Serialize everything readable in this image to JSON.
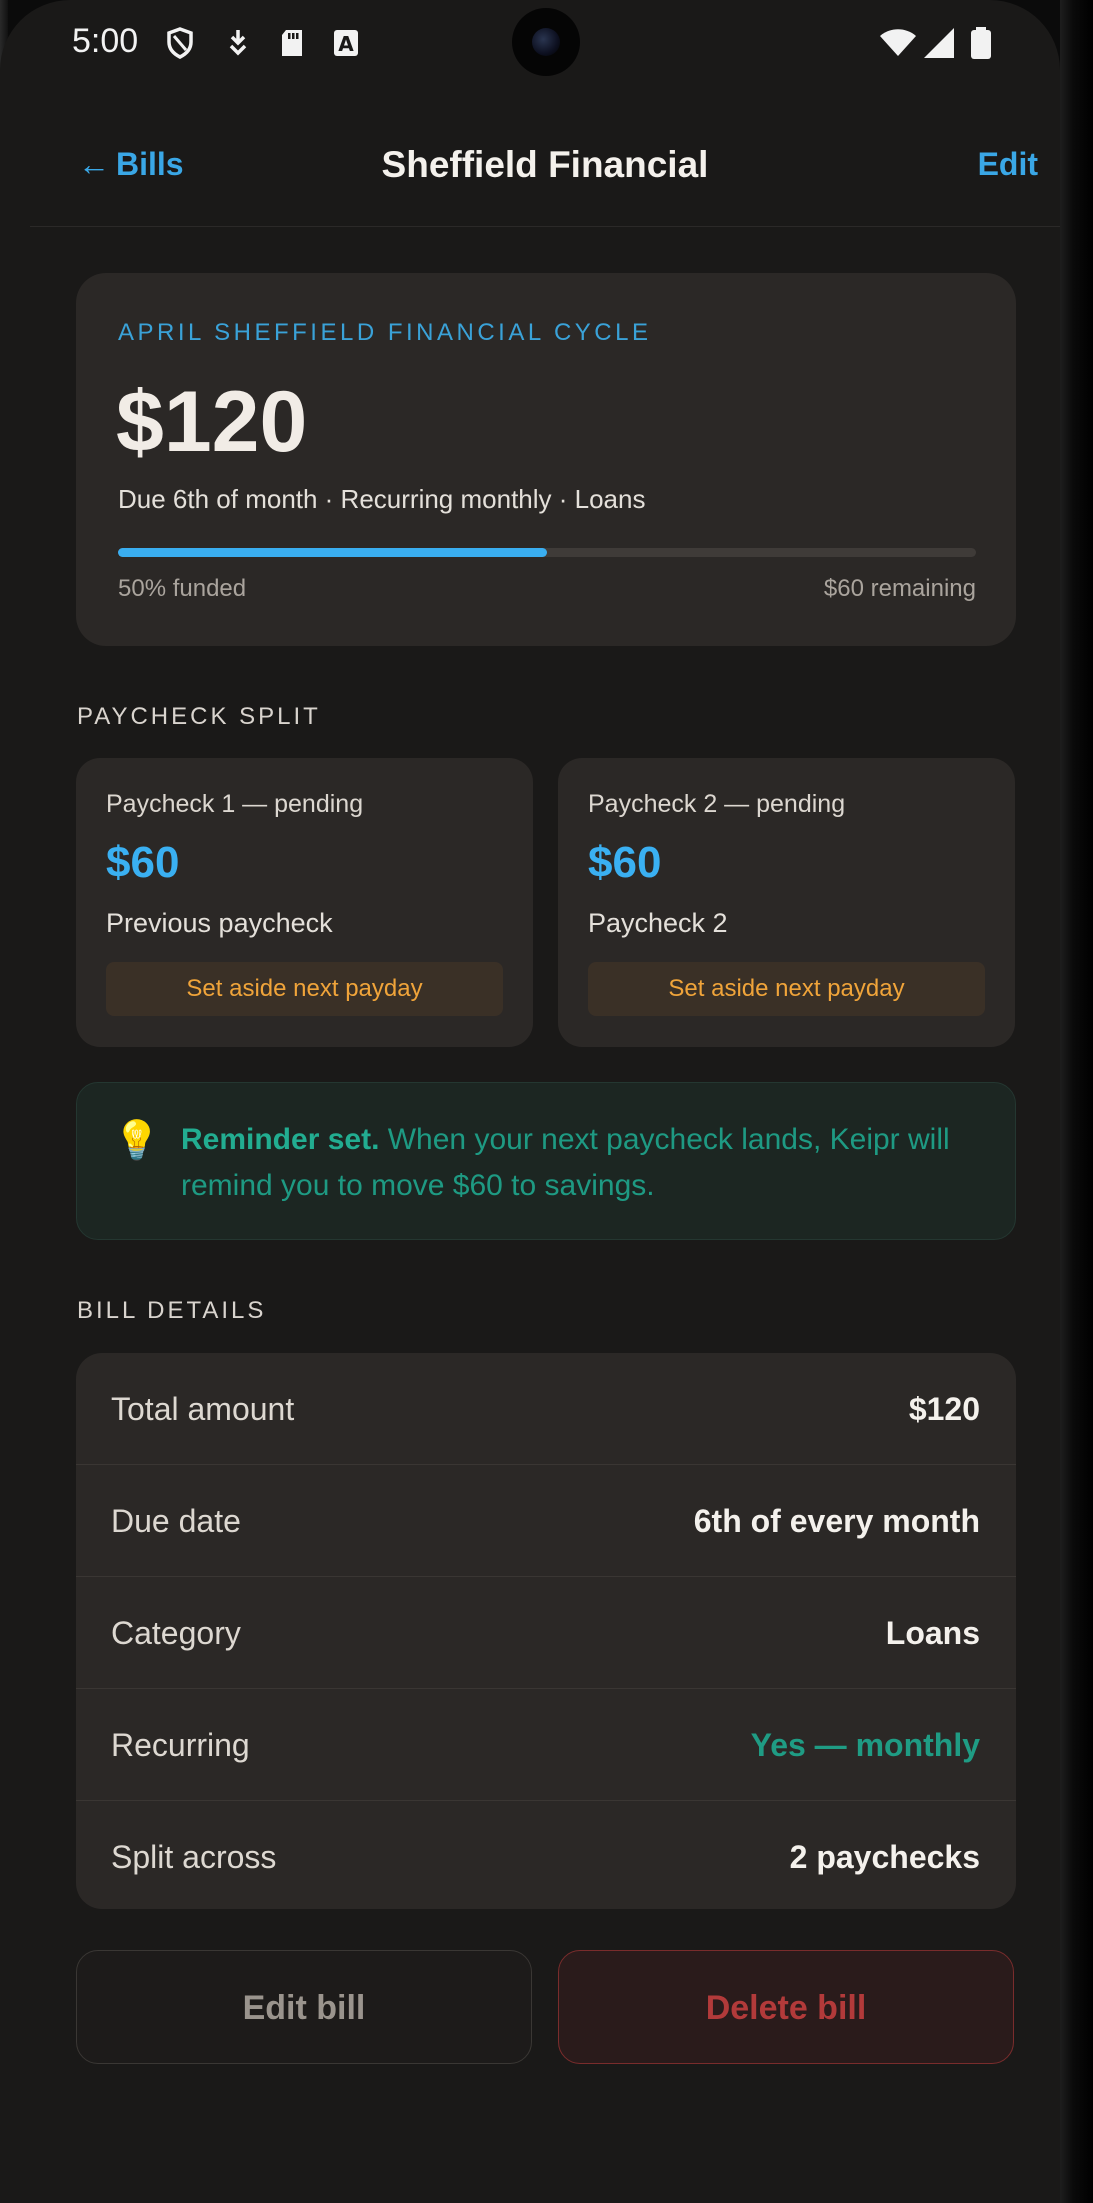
{
  "status_bar": {
    "time": "5:00",
    "icons": [
      "shield-icon",
      "download-icon",
      "sd-card-icon",
      "font-icon"
    ],
    "right_icons": [
      "wifi-icon",
      "cellular-signal-icon",
      "battery-icon"
    ]
  },
  "nav": {
    "back_arrow": "←",
    "back_label": "Bills",
    "title": "Sheffield Financial",
    "edit_label": "Edit"
  },
  "hero": {
    "eyebrow": "APRIL SHEFFIELD FINANCIAL CYCLE",
    "amount": "$120",
    "meta": "Due 6th of month · Recurring monthly · Loans",
    "progress_fraction": 0.5,
    "funded_label": "50% funded",
    "remaining_label": "$60 remaining",
    "accent_color": "#3aaef0"
  },
  "paycheck_split": {
    "heading": "PAYCHECK SPLIT",
    "cards": [
      {
        "status": "Paycheck 1 — pending",
        "amount": "$60",
        "source": "Previous paycheck",
        "action": "Set aside next payday"
      },
      {
        "status": "Paycheck 2 — pending",
        "amount": "$60",
        "source": "Paycheck 2",
        "action": "Set aside next payday"
      }
    ]
  },
  "reminder": {
    "icon": "lightbulb-icon",
    "glyph": "💡",
    "bold": "Reminder set.",
    "text": " When your next paycheck lands, Keipr will remind you to move $60 to savings."
  },
  "bill_details": {
    "heading": "BILL DETAILS",
    "rows": [
      {
        "label": "Total amount",
        "value": "$120"
      },
      {
        "label": "Due date",
        "value": "6th of every month"
      },
      {
        "label": "Category",
        "value": "Loans"
      },
      {
        "label": "Recurring",
        "value": "Yes — monthly"
      },
      {
        "label": "Split across",
        "value": "2 paychecks"
      }
    ]
  },
  "actions": {
    "edit_label": "Edit bill",
    "delete_label": "Delete bill"
  }
}
